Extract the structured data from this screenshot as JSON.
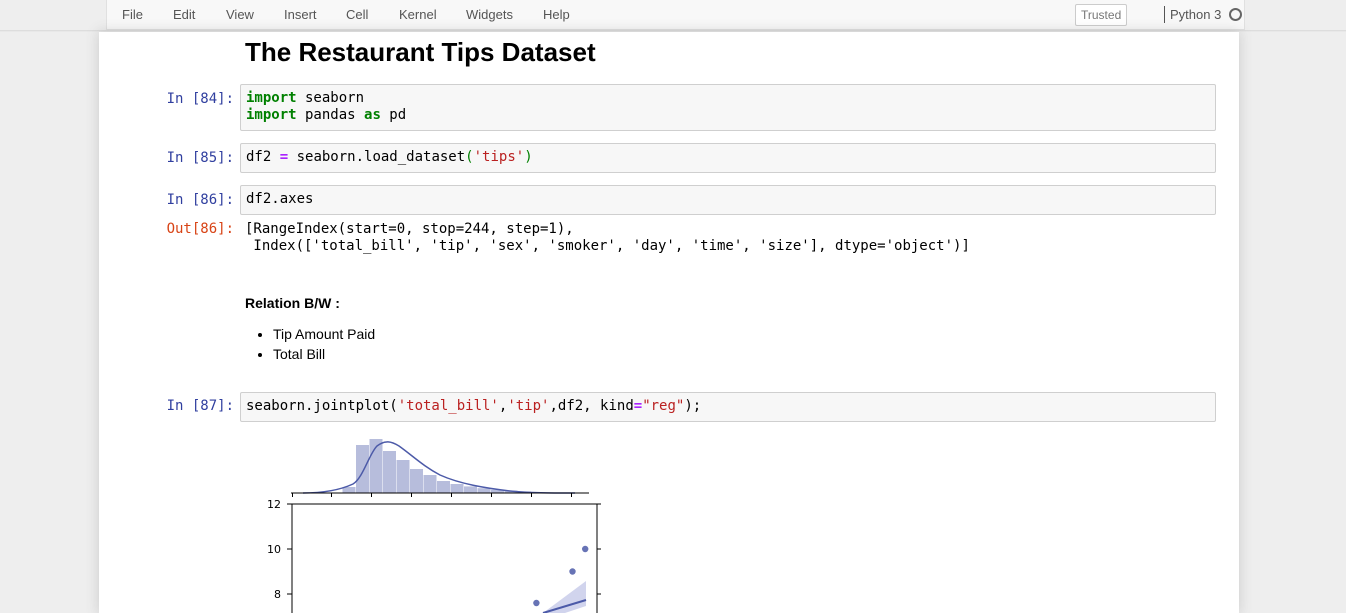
{
  "menu": {
    "items": [
      "File",
      "Edit",
      "View",
      "Insert",
      "Cell",
      "Kernel",
      "Widgets",
      "Help"
    ],
    "trusted": "Trusted",
    "kernel": "Python 3"
  },
  "notebook": {
    "title": "The Restaurant Tips Dataset",
    "cells": [
      {
        "prompt": "In [84]:",
        "lines": [
          "import seaborn",
          "import pandas as pd"
        ]
      },
      {
        "prompt": "In [85]:",
        "code": "df2 = seaborn.load_dataset('tips')"
      },
      {
        "prompt": "In [86]:",
        "code": "df2.axes"
      },
      {
        "out_prompt": "Out[86]:",
        "output_lines": [
          "[RangeIndex(start=0, stop=244, step=1),",
          " Index(['total_bill', 'tip', 'sex', 'smoker', 'day', 'time', 'size'], dtype='object')]"
        ]
      },
      {
        "prompt": "In [87]:",
        "code": "seaborn.jointplot('total_bill','tip',df2, kind=\"reg\");"
      }
    ],
    "markdown": {
      "heading": "Relation B/W :",
      "items": [
        "Tip Amount Paid",
        "Total Bill"
      ]
    }
  },
  "chart_data": {
    "type": "scatter",
    "title": "",
    "xlabel": "",
    "ylabel": "",
    "yticks": [
      "12",
      "10",
      "8"
    ],
    "visible_points": [
      {
        "x": 50.8,
        "y": 10.0
      },
      {
        "x": 48.3,
        "y": 9.0
      },
      {
        "x": 41.2,
        "y": 7.6
      }
    ],
    "marginal_histogram_x": [
      2,
      16,
      18,
      14,
      11,
      8,
      6,
      4,
      3,
      2.2,
      1.6,
      1.1,
      0.8,
      0.5
    ],
    "color": "#4c5aa8"
  }
}
